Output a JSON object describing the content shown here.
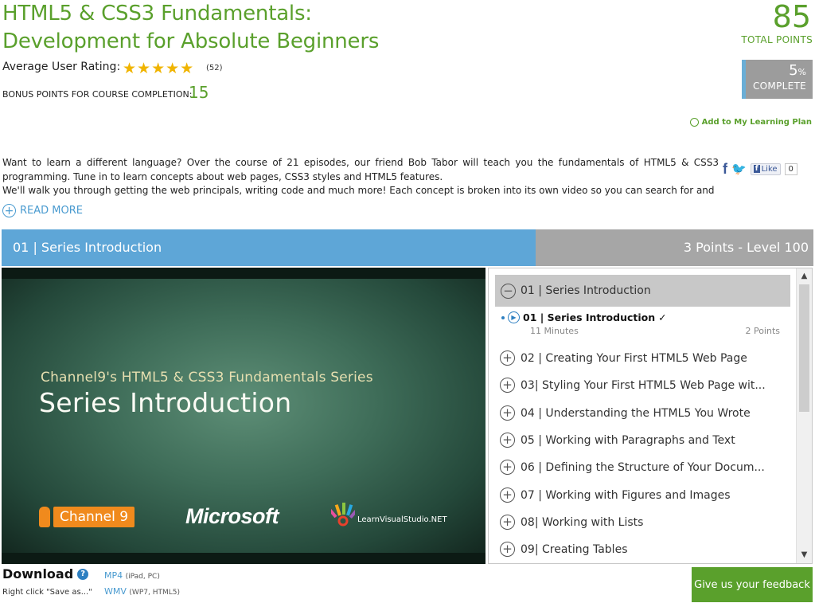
{
  "course": {
    "title_line1": "HTML5 & CSS3 Fundamentals:",
    "title_line2": "Development for Absolute Beginners",
    "rating_label": "Average User Rating:",
    "rating_stars": "★★★★★",
    "rating_count": "(52)",
    "bonus_label": "BONUS POINTS FOR COURSE COMPLETION:",
    "bonus_value": "15"
  },
  "score": {
    "total_points": "85",
    "total_label": "TOTAL POINTS",
    "complete_pct": "5",
    "complete_pct_sign": "%",
    "complete_label": "COMPLETE",
    "progress_fraction": 0.05
  },
  "learning_plan_link": "Add to My Learning Plan",
  "description": {
    "line1": "Want to learn a different language? Over the course of 21 episodes, our friend Bob Tabor will teach you the fundamentals of HTML5 & CSS3 programming. Tune in to learn concepts about web pages, CSS3 styles and HTML5 features.",
    "line2": "We'll walk you through getting the web principals, writing code and much more! Each concept is broken into its own video so you can search for and",
    "read_more": "READ MORE"
  },
  "social": {
    "facebook": "f",
    "twitter": "🐦",
    "like_label": "Like",
    "like_count": "0"
  },
  "episode_bar": {
    "title": "01 | Series Introduction",
    "points_level": "3 Points -  Level 100"
  },
  "video": {
    "series_line": "Channel9's HTML5 & CSS3 Fundamentals Series",
    "title": "Series Introduction",
    "channel9": "Channel 9",
    "microsoft": "Microsoft",
    "lvs": "LearnVisualStudio.NET"
  },
  "playlist": {
    "section_title": "01 | Series Introduction",
    "current": {
      "title": "01 | Series Introduction",
      "check": "✓",
      "duration": "11 Minutes",
      "points": "2 Points"
    },
    "items": [
      "02 | Creating Your First HTML5 Web Page",
      "03| Styling Your First HTML5 Web Page wit...",
      "04 | Understanding the HTML5 You Wrote",
      "05 | Working with Paragraphs and Text",
      "06 | Defining the Structure of Your Docum...",
      "07 | Working with Figures and Images",
      "08| Working with Lists",
      "09| Creating Tables"
    ]
  },
  "download": {
    "title": "Download",
    "hint": "Right click \"Save as...\"",
    "mp4": "MP4",
    "mp4_note": "(iPad, PC)",
    "wmv": "WMV",
    "wmv_note": "(WP7, HTML5)"
  },
  "feedback_button": "Give us your feedback"
}
